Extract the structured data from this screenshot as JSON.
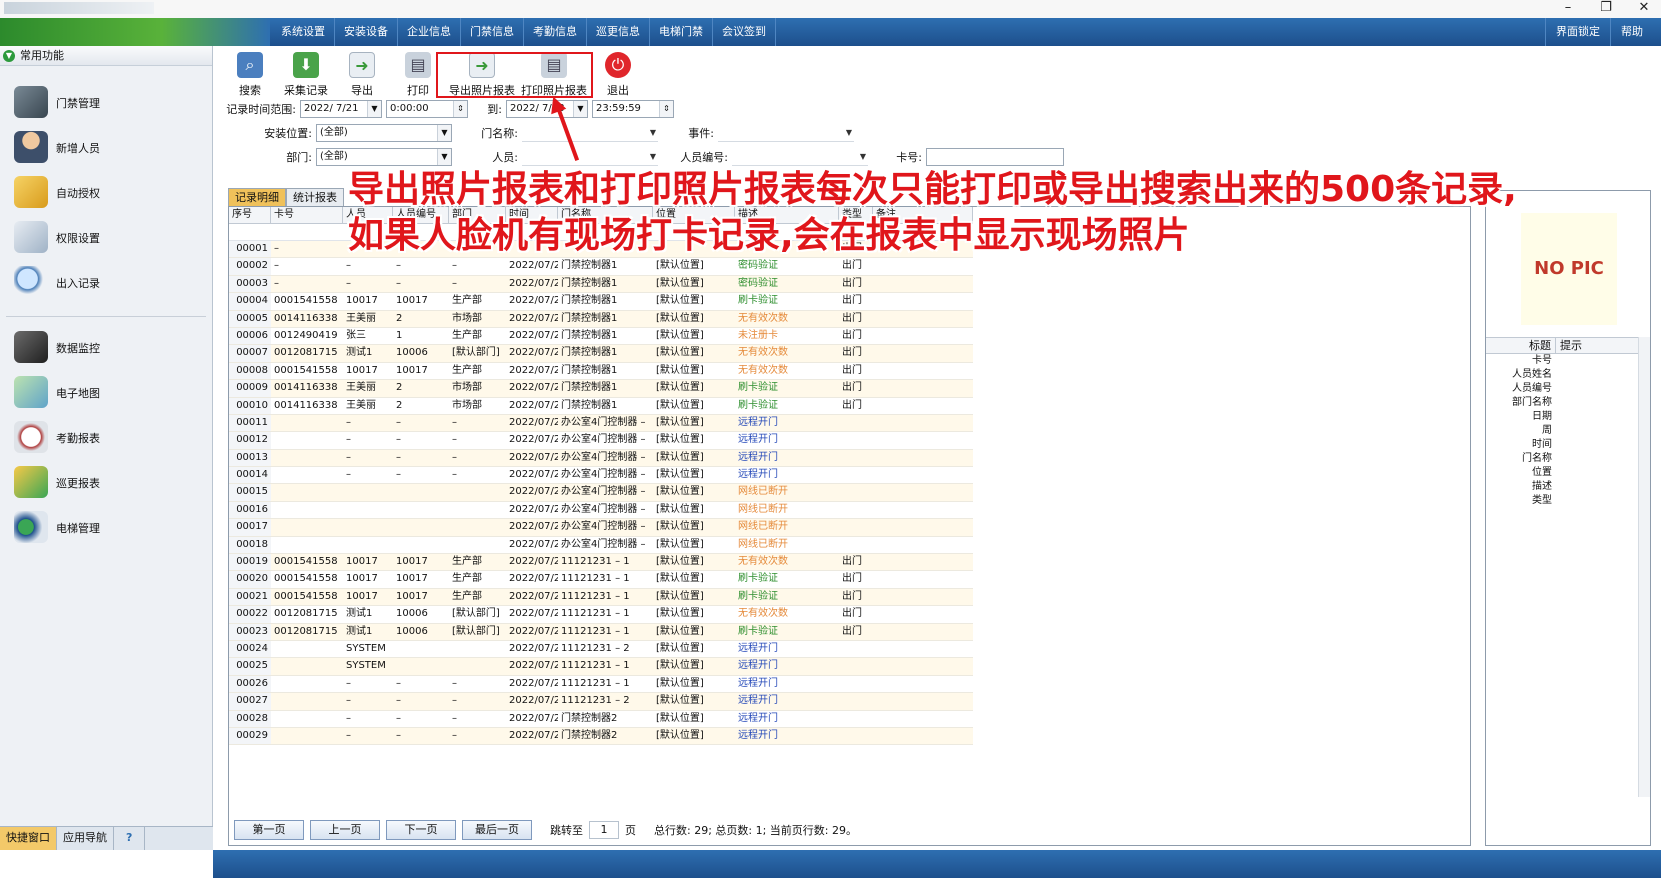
{
  "menu": [
    "系统设置",
    "安装设备",
    "企业信息",
    "门禁信息",
    "考勤信息",
    "巡更信息",
    "电梯门禁",
    "会议签到"
  ],
  "menu_right": [
    "界面锁定",
    "帮助"
  ],
  "window_controls": [
    "–",
    "❐",
    "✕"
  ],
  "sidebar": {
    "header": "常用功能",
    "items_top": [
      "门禁管理",
      "新增人员",
      "自动授权",
      "权限设置",
      "出入记录"
    ],
    "items_bottom": [
      "数据监控",
      "电子地图",
      "考勤报表",
      "巡更报表",
      "电梯管理"
    ],
    "bottom_tabs": [
      "快捷窗口",
      "应用导航",
      "?"
    ]
  },
  "toolbar": [
    "搜索",
    "采集记录",
    "导出",
    "打印",
    "导出照片报表",
    "打印照片报表",
    "退出"
  ],
  "filters": {
    "time_range_label": "记录时间范围:",
    "date_from": "2022/ 7/21",
    "time_from": "0:00:00",
    "to_label": "到:",
    "date_to": "2022/ 7/28",
    "time_to": "23:59:59",
    "location_label": "安装位置:",
    "location_value": "(全部)",
    "door_label": "门名称:",
    "event_label": "事件:",
    "dept_label": "部门:",
    "dept_value": "(全部)",
    "person_label": "人员:",
    "person_no_label": "人员编号:",
    "card_label": "卡号:"
  },
  "tabs": [
    "记录明细",
    "统计报表"
  ],
  "grid": {
    "headers": [
      "序号",
      "卡号",
      "人员",
      "人员编号",
      "部门",
      "时间",
      "门名称",
      "位置",
      "描述",
      "类型",
      "备注"
    ],
    "rows": [
      [
        "00001",
        "–",
        "",
        "",
        "",
        "",
        "",
        "",
        "",
        "出门",
        ""
      ],
      [
        "00002",
        "–",
        "–",
        "–",
        "–",
        "2022/07/2",
        "门禁控制器1",
        "[默认位置]",
        "密码验证",
        "出门",
        ""
      ],
      [
        "00003",
        "–",
        "–",
        "–",
        "–",
        "2022/07/2",
        "门禁控制器1",
        "[默认位置]",
        "密码验证",
        "出门",
        ""
      ],
      [
        "00004",
        "0001541558",
        "10017",
        "10017",
        "生产部",
        "2022/07/2",
        "门禁控制器1",
        "[默认位置]",
        "刷卡验证",
        "出门",
        ""
      ],
      [
        "00005",
        "0014116338",
        "王美丽",
        "2",
        "市场部",
        "2022/07/2",
        "门禁控制器1",
        "[默认位置]",
        "无有效次数",
        "出门",
        ""
      ],
      [
        "00006",
        "0012490419",
        "张三",
        "1",
        "生产部",
        "2022/07/2",
        "门禁控制器1",
        "[默认位置]",
        "未注册卡",
        "出门",
        ""
      ],
      [
        "00007",
        "0012081715",
        "测试1",
        "10006",
        "[默认部门]",
        "2022/07/2",
        "门禁控制器1",
        "[默认位置]",
        "无有效次数",
        "出门",
        ""
      ],
      [
        "00008",
        "0001541558",
        "10017",
        "10017",
        "生产部",
        "2022/07/2",
        "门禁控制器1",
        "[默认位置]",
        "无有效次数",
        "出门",
        ""
      ],
      [
        "00009",
        "0014116338",
        "王美丽",
        "2",
        "市场部",
        "2022/07/2",
        "门禁控制器1",
        "[默认位置]",
        "刷卡验证",
        "出门",
        ""
      ],
      [
        "00010",
        "0014116338",
        "王美丽",
        "2",
        "市场部",
        "2022/07/2",
        "门禁控制器1",
        "[默认位置]",
        "刷卡验证",
        "出门",
        ""
      ],
      [
        "00011",
        "",
        "–",
        "–",
        "–",
        "2022/07/2",
        "办公室4门控制器 –",
        "[默认位置]",
        "远程开门",
        "",
        ""
      ],
      [
        "00012",
        "",
        "–",
        "–",
        "–",
        "2022/07/2",
        "办公室4门控制器 –",
        "[默认位置]",
        "远程开门",
        "",
        ""
      ],
      [
        "00013",
        "",
        "–",
        "–",
        "–",
        "2022/07/2",
        "办公室4门控制器 –",
        "[默认位置]",
        "远程开门",
        "",
        ""
      ],
      [
        "00014",
        "",
        "–",
        "–",
        "–",
        "2022/07/2",
        "办公室4门控制器 –",
        "[默认位置]",
        "远程开门",
        "",
        ""
      ],
      [
        "00015",
        "",
        "",
        "",
        "",
        "2022/07/2",
        "办公室4门控制器 –",
        "[默认位置]",
        "网线已断开",
        "",
        ""
      ],
      [
        "00016",
        "",
        "",
        "",
        "",
        "2022/07/2",
        "办公室4门控制器 –",
        "[默认位置]",
        "网线已断开",
        "",
        ""
      ],
      [
        "00017",
        "",
        "",
        "",
        "",
        "2022/07/2",
        "办公室4门控制器 –",
        "[默认位置]",
        "网线已断开",
        "",
        ""
      ],
      [
        "00018",
        "",
        "",
        "",
        "",
        "2022/07/2",
        "办公室4门控制器 –",
        "[默认位置]",
        "网线已断开",
        "",
        ""
      ],
      [
        "00019",
        "0001541558",
        "10017",
        "10017",
        "生产部",
        "2022/07/2",
        "11121231 – 1",
        "[默认位置]",
        "无有效次数",
        "出门",
        ""
      ],
      [
        "00020",
        "0001541558",
        "10017",
        "10017",
        "生产部",
        "2022/07/2",
        "11121231 – 1",
        "[默认位置]",
        "刷卡验证",
        "出门",
        ""
      ],
      [
        "00021",
        "0001541558",
        "10017",
        "10017",
        "生产部",
        "2022/07/2",
        "11121231 – 1",
        "[默认位置]",
        "刷卡验证",
        "出门",
        ""
      ],
      [
        "00022",
        "0012081715",
        "测试1",
        "10006",
        "[默认部门]",
        "2022/07/2",
        "11121231 – 1",
        "[默认位置]",
        "无有效次数",
        "出门",
        ""
      ],
      [
        "00023",
        "0012081715",
        "测试1",
        "10006",
        "[默认部门]",
        "2022/07/2",
        "11121231 – 1",
        "[默认位置]",
        "刷卡验证",
        "出门",
        ""
      ],
      [
        "00024",
        "",
        "SYSTEM",
        "",
        "",
        "2022/07/2",
        "11121231 – 2",
        "[默认位置]",
        "远程开门",
        "",
        ""
      ],
      [
        "00025",
        "",
        "SYSTEM",
        "",
        "",
        "2022/07/2",
        "11121231 – 1",
        "[默认位置]",
        "远程开门",
        "",
        ""
      ],
      [
        "00026",
        "",
        "–",
        "–",
        "–",
        "2022/07/2",
        "11121231 – 1",
        "[默认位置]",
        "远程开门",
        "",
        ""
      ],
      [
        "00027",
        "",
        "–",
        "–",
        "–",
        "2022/07/2",
        "11121231 – 2",
        "[默认位置]",
        "远程开门",
        "",
        ""
      ],
      [
        "00028",
        "",
        "–",
        "–",
        "–",
        "2022/07/2",
        "门禁控制器2",
        "[默认位置]",
        "远程开门",
        "",
        ""
      ],
      [
        "00029",
        "",
        "–",
        "–",
        "–",
        "2022/07/2",
        "门禁控制器2",
        "[默认位置]",
        "远程开门",
        "",
        ""
      ]
    ]
  },
  "status_colors": {
    "刷卡验证": "#2f8f2f",
    "密码验证": "#2f8f2f",
    "无有效次数": "#e58a3a",
    "未注册卡": "#e58a3a",
    "网线已断开": "#e58a3a",
    "远程开门": "#2448b8"
  },
  "pager": {
    "first": "第一页",
    "prev": "上一页",
    "next": "下一页",
    "last": "最后一页",
    "jump_label": "跳转至",
    "page_value": "1",
    "page_unit": "页",
    "summary": "总行数: 29; 总页数: 1; 当前页行数: 29。"
  },
  "right_panel": {
    "no_pic": "NO PIC",
    "col_title": "标题",
    "col_hint": "提示",
    "fields": [
      "卡号",
      "人员姓名",
      "人员编号",
      "部门名称",
      "日期",
      "周",
      "时间",
      "门名称",
      "位置",
      "描述",
      "类型"
    ]
  },
  "annotation": {
    "line1": "导出照片报表和打印照片报表每次只能打印或导出搜索出来的500条记录,",
    "line2": "如果人脸机有现场打卡记录,会在报表中显示现场照片"
  }
}
